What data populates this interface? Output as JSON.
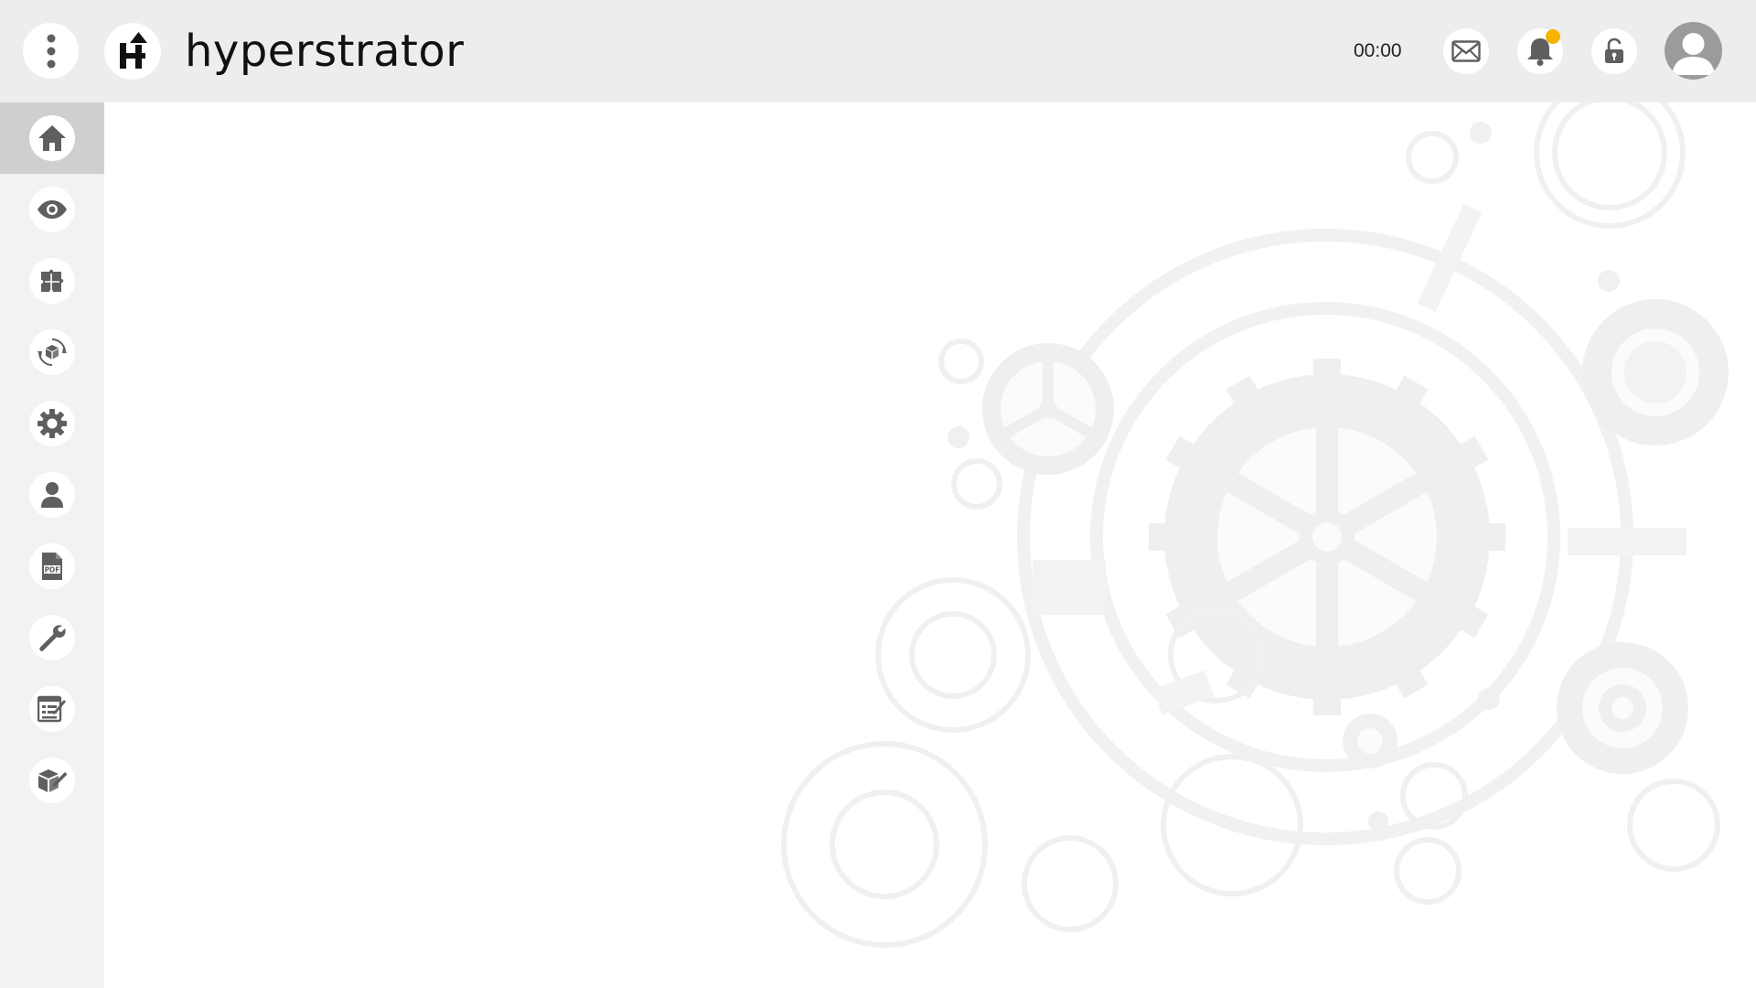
{
  "header": {
    "brand": "hyperstrator",
    "timer": "00:00",
    "logo_letter": "H",
    "notification_badge_color": "#f5b400"
  },
  "icons": {
    "menu": "more-vertical-icon",
    "mail": "mail-icon",
    "bell": "bell-icon",
    "lock": "unlock-icon",
    "avatar": "user-avatar-icon"
  },
  "sidebar": {
    "active_index": 0,
    "items": [
      {
        "icon": "home-icon"
      },
      {
        "icon": "eye-icon"
      },
      {
        "icon": "puzzle-icon"
      },
      {
        "icon": "cube-sync-icon"
      },
      {
        "icon": "gear-icon"
      },
      {
        "icon": "user-icon"
      },
      {
        "icon": "pdf-file-icon"
      },
      {
        "icon": "wrench-icon"
      },
      {
        "icon": "checklist-icon"
      },
      {
        "icon": "cube-edit-icon"
      }
    ]
  },
  "colors": {
    "topbar": "#ededed",
    "sidebar": "#f2f2f2",
    "sidebar_active": "#cfcfcf",
    "icon": "#5f5f5f"
  }
}
